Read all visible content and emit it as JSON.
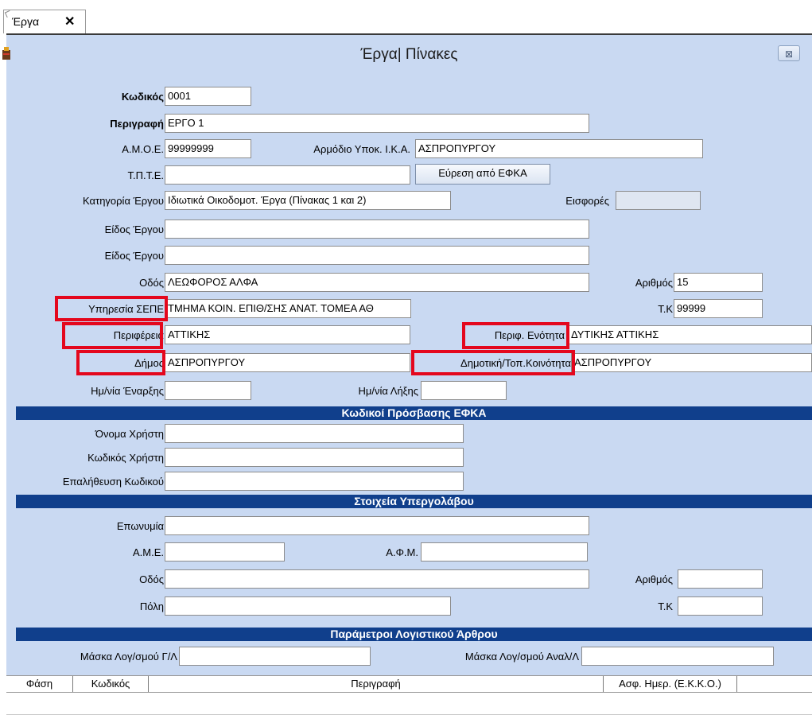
{
  "tab": {
    "label": "Έργα",
    "close": "✕"
  },
  "window": {
    "title": "Έργα| Πίνακες",
    "close": "⊠"
  },
  "form": {
    "code": {
      "label": "Κωδικός",
      "value": "0001"
    },
    "description": {
      "label": "Περιγραφή",
      "value": "ΕΡΓΟ 1"
    },
    "amoe": {
      "label": "Α.Μ.Ο.Ε.",
      "value": "99999999"
    },
    "ika": {
      "label": "Αρμόδιο Υποκ. Ι.Κ.Α.",
      "value": "ΑΣΠΡΟΠΥΡΓΟΥ"
    },
    "tpte": {
      "label": "Τ.Π.Τ.Ε.",
      "value": ""
    },
    "efka_button": "Εύρεση από ΕΦΚΑ",
    "category": {
      "label": "Κατηγορία Έργου",
      "value": "Ιδιωτικά Οικοδομοτ. Έργα (Πίνακας 1 και 2)"
    },
    "contributions": {
      "label": "Εισφορές",
      "value": ""
    },
    "type1": {
      "label": "Είδος Έργου",
      "value": ""
    },
    "type2": {
      "label": "Είδος Έργου",
      "value": ""
    },
    "street": {
      "label": "Οδός",
      "value": "ΛΕΩΦΟΡΟΣ ΑΛΦΑ"
    },
    "number": {
      "label": "Αριθμός",
      "value": "15"
    },
    "sepe": {
      "label": "Υπηρεσία ΣΕΠΕ",
      "value": "ΤΜΗΜΑ ΚΟΙΝ. ΕΠΙΘ/ΣΗΣ ΑΝΑΤ. ΤΟΜΕΑ ΑΘ"
    },
    "tk": {
      "label": "Τ.Κ",
      "value": "99999"
    },
    "region": {
      "label": "Περιφέρεια",
      "value": "ΑΤΤΙΚΗΣ"
    },
    "regional_unit": {
      "label": "Περιφ. Ενότητα",
      "value": "ΔΥΤΙΚΗΣ ΑΤΤΙΚΗΣ"
    },
    "municipality": {
      "label": "Δήμος",
      "value": "ΑΣΠΡΟΠΥΡΓΟΥ"
    },
    "community": {
      "label": "Δημοτική/Τοπ.Κοινότητα",
      "value": "ΑΣΠΡΟΠΥΡΓΟΥ"
    },
    "start_date": {
      "label": "Ημ/νία Έναρξης",
      "value": ""
    },
    "end_date": {
      "label": "Ημ/νία Λήξης",
      "value": ""
    }
  },
  "efka": {
    "header": "Κωδικοί Πρόσβασης ΕΦΚΑ",
    "username": {
      "label": "Όνομα Χρήστη",
      "value": ""
    },
    "user_code": {
      "label": "Κωδικός Χρήστη",
      "value": ""
    },
    "confirm": {
      "label": "Επαλήθευση Κωδικού",
      "value": ""
    }
  },
  "subcontractor": {
    "header": "Στοιχεία Υπεργολάβου",
    "name": {
      "label": "Επωνυμία",
      "value": ""
    },
    "ame": {
      "label": "Α.Μ.Ε.",
      "value": ""
    },
    "afm": {
      "label": "Α.Φ.Μ.",
      "value": ""
    },
    "street": {
      "label": "Οδός",
      "value": ""
    },
    "number": {
      "label": "Αριθμός",
      "value": ""
    },
    "city": {
      "label": "Πόλη",
      "value": ""
    },
    "tk": {
      "label": "Τ.Κ",
      "value": ""
    }
  },
  "accounting": {
    "header": "Παράμετροι Λογιστικού Άρθρου",
    "gl_mask": {
      "label": "Μάσκα Λογ/σμού Γ/Λ",
      "value": ""
    },
    "an_mask": {
      "label": "Μάσκα Λογ/σμού Αναλ/Λ",
      "value": ""
    }
  },
  "grid": {
    "columns": [
      "Φάση",
      "Κωδικός",
      "Περιγραφή",
      "Ασφ. Ημερ. (Ε.Κ.Κ.Ο.)"
    ]
  },
  "colors": {
    "form_bg": "#c9d9f2",
    "section_bg": "#103f8c",
    "highlight": "#e4071d"
  }
}
